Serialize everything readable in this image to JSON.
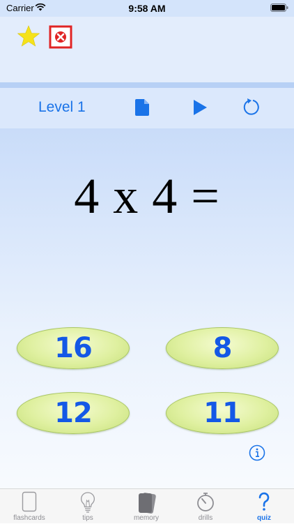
{
  "status_bar": {
    "carrier": "Carrier",
    "time": "9:58 AM"
  },
  "toolbar": {
    "level_label": "Level 1"
  },
  "question": {
    "text": "4 x 4 ="
  },
  "answers": [
    {
      "label": "16"
    },
    {
      "label": "8"
    },
    {
      "label": "12"
    },
    {
      "label": "11"
    }
  ],
  "tabs": [
    {
      "label": "flashcards",
      "icon": "card-icon",
      "active": false
    },
    {
      "label": "tips",
      "icon": "lightbulb-icon",
      "active": false
    },
    {
      "label": "memory",
      "icon": "cards-stack-icon",
      "active": false
    },
    {
      "label": "drills",
      "icon": "timer-icon",
      "active": false
    },
    {
      "label": "quiz",
      "icon": "question-mark-icon",
      "active": true
    }
  ],
  "colors": {
    "accent": "#1a73e8",
    "answer_text": "#1458e6",
    "star": "#f5e21a",
    "close_box": "#e02424"
  }
}
